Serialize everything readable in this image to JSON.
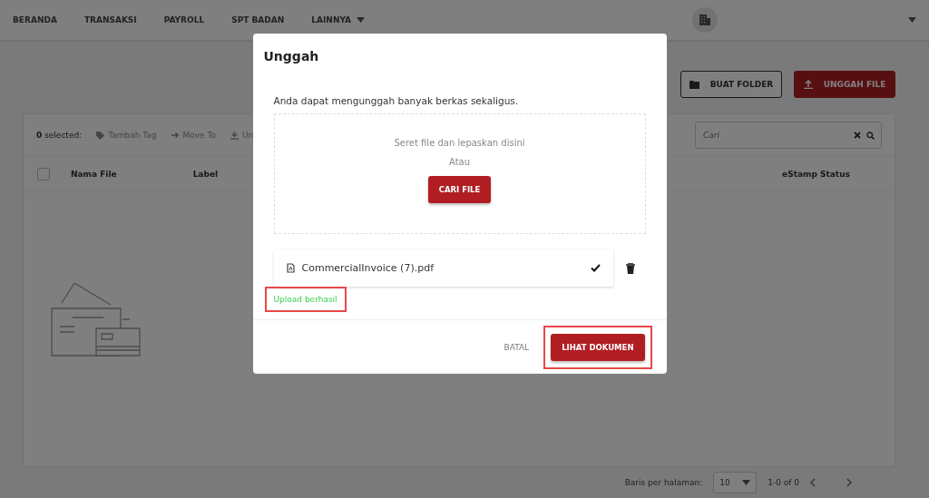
{
  "nav": {
    "items": [
      {
        "label": "BERANDA",
        "dropdown": false
      },
      {
        "label": "TRANSAKSI",
        "dropdown": false
      },
      {
        "label": "PAYROLL",
        "dropdown": false
      },
      {
        "label": "SPT BADAN",
        "dropdown": false
      },
      {
        "label": "LAINNYA",
        "dropdown": true
      }
    ]
  },
  "actions": [
    {
      "label": "BUAT FOLDER",
      "kind": "outline"
    },
    {
      "label": "UNGGAH FILE",
      "kind": "primary"
    }
  ],
  "toolbar": {
    "count": "0",
    "selected_label": "selected:",
    "actions": [
      {
        "label": "Tambah Tag",
        "kind": "tag"
      },
      {
        "label": "Move To",
        "kind": "move"
      },
      {
        "label": "Un",
        "kind": "download"
      }
    ],
    "search": {
      "placeholder": "Cari"
    }
  },
  "table": {
    "select_all": {
      "checked": false
    },
    "columns": [
      "Nama File",
      "Label",
      "eStamp Status"
    ]
  },
  "pagination": {
    "label": "Baris per halaman:",
    "rows_per_page": "10",
    "range": "1-0 of 0"
  },
  "modal": {
    "title": "Unggah",
    "intro": "Anda dapat mengunggah banyak berkas sekaligus.",
    "dropzone": {
      "hint": "Seret file dan lepaskan disini",
      "or": "Atau",
      "button": "CARI FILE"
    },
    "files": [
      {
        "name": "CommercialInvoice (7).pdf",
        "uploaded": true
      }
    ],
    "status": {
      "text": "Upload berhasil",
      "highlighted": true
    },
    "cancel": "BATAL",
    "confirm": {
      "label": "LIHAT DOKUMEN",
      "highlighted": true
    }
  }
}
